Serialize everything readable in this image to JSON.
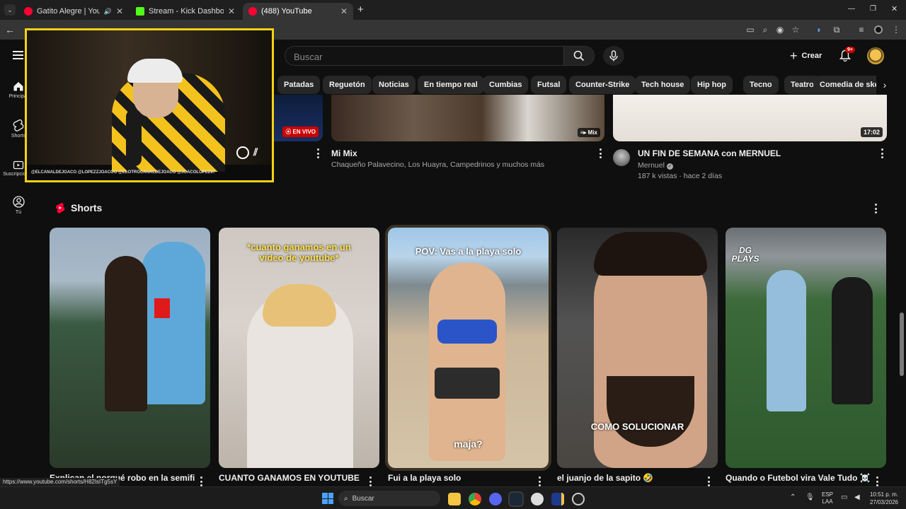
{
  "browser": {
    "tabs": [
      {
        "title": "Gatito Alegre | YouTube Mu",
        "active": false
      },
      {
        "title": "Stream - Kick Dashboard",
        "active": false
      },
      {
        "title": "(488) YouTube",
        "active": true
      }
    ],
    "new_tab": "+",
    "window_controls": [
      "—",
      "❐",
      "✕"
    ]
  },
  "youtube": {
    "search_placeholder": "Buscar",
    "create_label": "Crear",
    "notif_badge": "9+",
    "chips": [
      "Patadas",
      "Reguetón",
      "Noticias",
      "En tiempo real",
      "Cumbias",
      "Futsal",
      "Counter-Strike",
      "Tech house",
      "Hip hop",
      "Tecno",
      "Teatro",
      "Comedia de sketch"
    ],
    "sidebar": [
      {
        "label": "Principal",
        "icon": "home-icon"
      },
      {
        "label": "Shorts",
        "icon": "shorts-icon"
      },
      {
        "label": "Suscripciones",
        "icon": "subscriptions-icon"
      },
      {
        "label": "Tú",
        "icon": "you-icon"
      }
    ],
    "videos": [
      {
        "badge": "EN VIVO"
      },
      {
        "title": "Mi Mix",
        "meta": "Chaqueño Palavecino, Los Huayra, Campedrinos y muchos más",
        "badge": "Mix"
      },
      {
        "title": "UN FIN DE SEMANA con MERNUEL",
        "channel": "Mernuel",
        "meta": "187 k vistas · hace 2 días",
        "duration": "17:02"
      }
    ],
    "shorts_heading": "Shorts",
    "shorts": [
      {
        "title": "Explican el porqué robo en la semifinal",
        "overlay": ""
      },
      {
        "title": "CUANTO GANAMOS EN YOUTUBE",
        "overlay": "*cuanto ganamos en un video de youtube*"
      },
      {
        "title": "Fui a la playa solo",
        "overlay": "POV: Vas a la playa solo",
        "overlay2": "maja?"
      },
      {
        "title": "el juanjo de la sapito 🤣",
        "overlay": "COMO SOLUCIONAR"
      },
      {
        "title": "Quando o Futebol vira Vale Tudo ☠️",
        "overlay": "DG PLAYS"
      }
    ]
  },
  "stream_overlay": {
    "ticker": "@ELCANALDEJOACO  @LOPEZZJOACOO  @ELOTROCANALDEJOACO  @JOACOLOPEZ97"
  },
  "status_url": "https://www.youtube.com/shorts/H82IsITg5sY",
  "taskbar": {
    "search_label": "Buscar",
    "lang": "ESP",
    "lang2": "LAA",
    "time": "10:51 p. m.",
    "date": "27/03/2026"
  }
}
